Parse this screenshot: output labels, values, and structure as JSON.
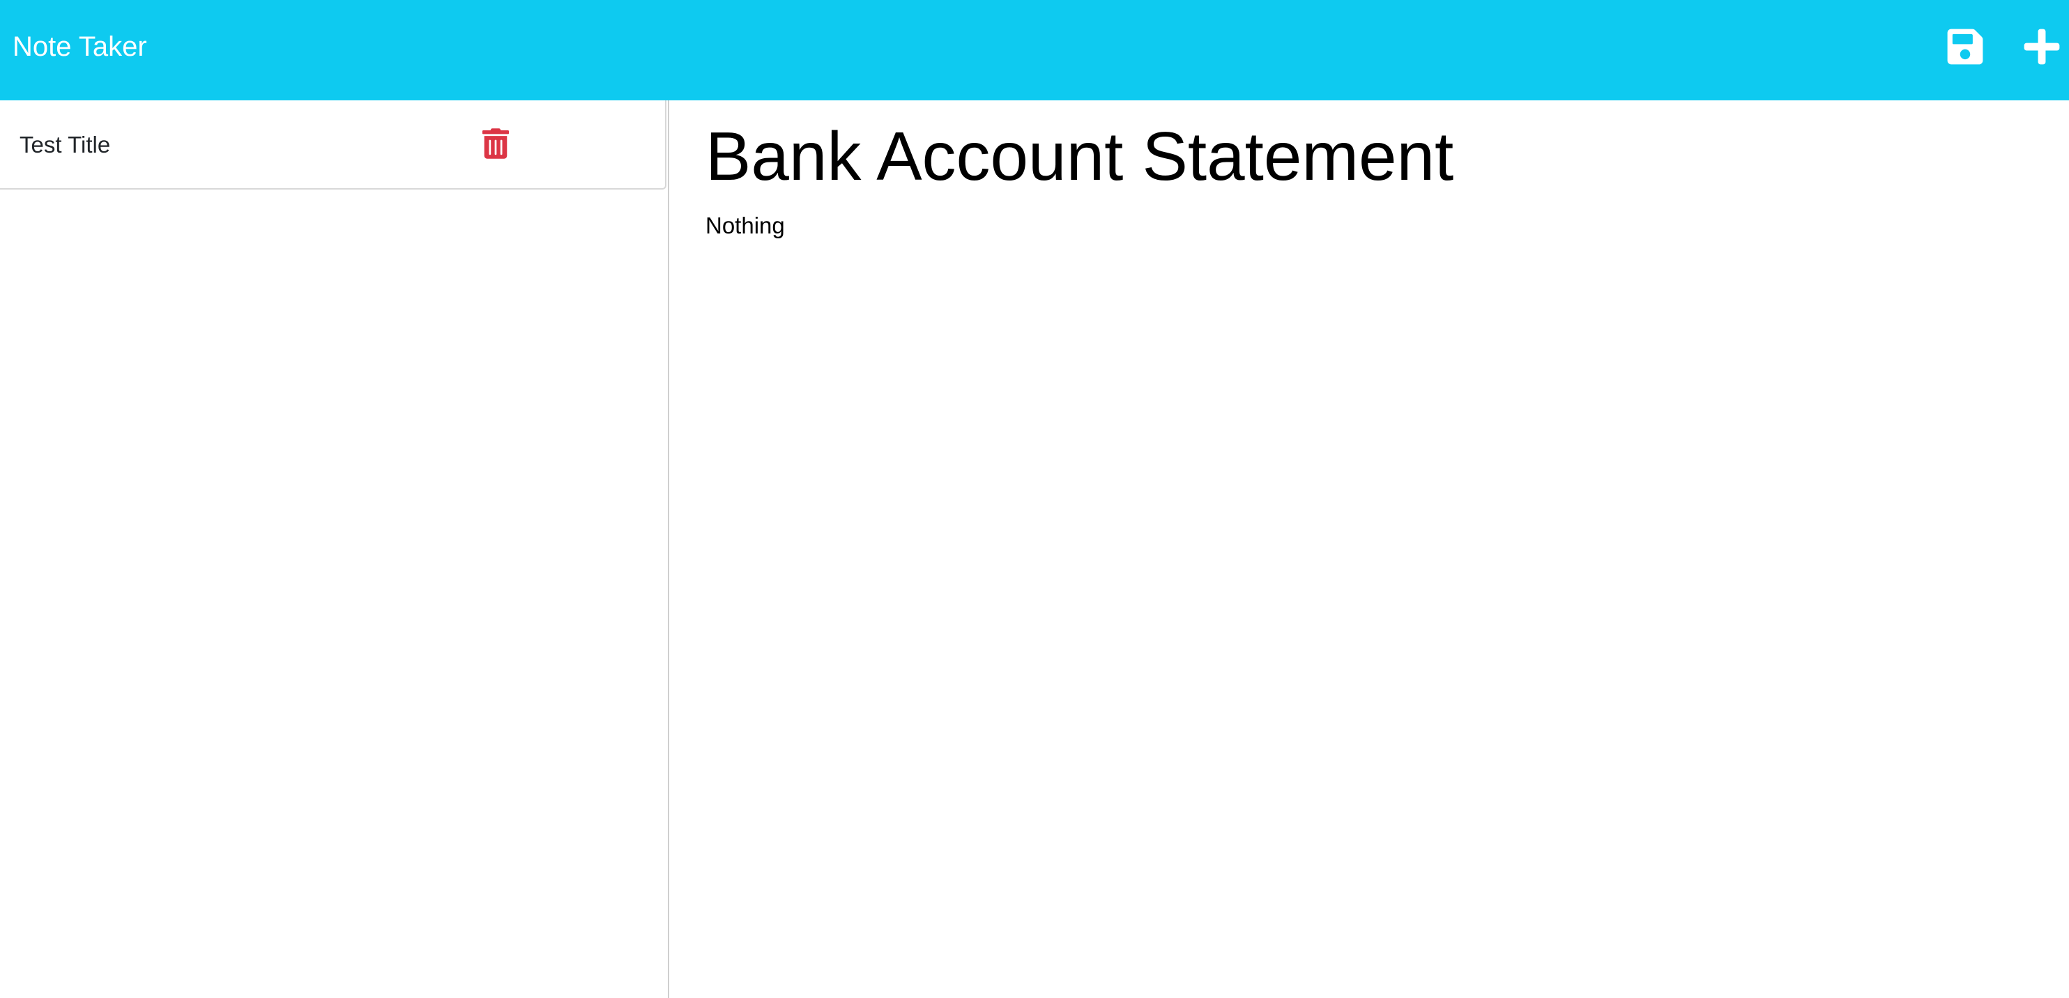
{
  "app": {
    "title": "Note Taker"
  },
  "toolbar": {
    "save_icon": "save-icon",
    "new_icon": "plus-icon"
  },
  "sidebar": {
    "notes": [
      {
        "title": "Test Title",
        "delete_icon": "trash-icon"
      }
    ]
  },
  "main": {
    "note_title": "Bank Account Statement",
    "note_text": "Nothing"
  },
  "colors": {
    "navbar": "#0ecaf0",
    "delete": "#dc3545",
    "nav_text": "#ffffff"
  }
}
